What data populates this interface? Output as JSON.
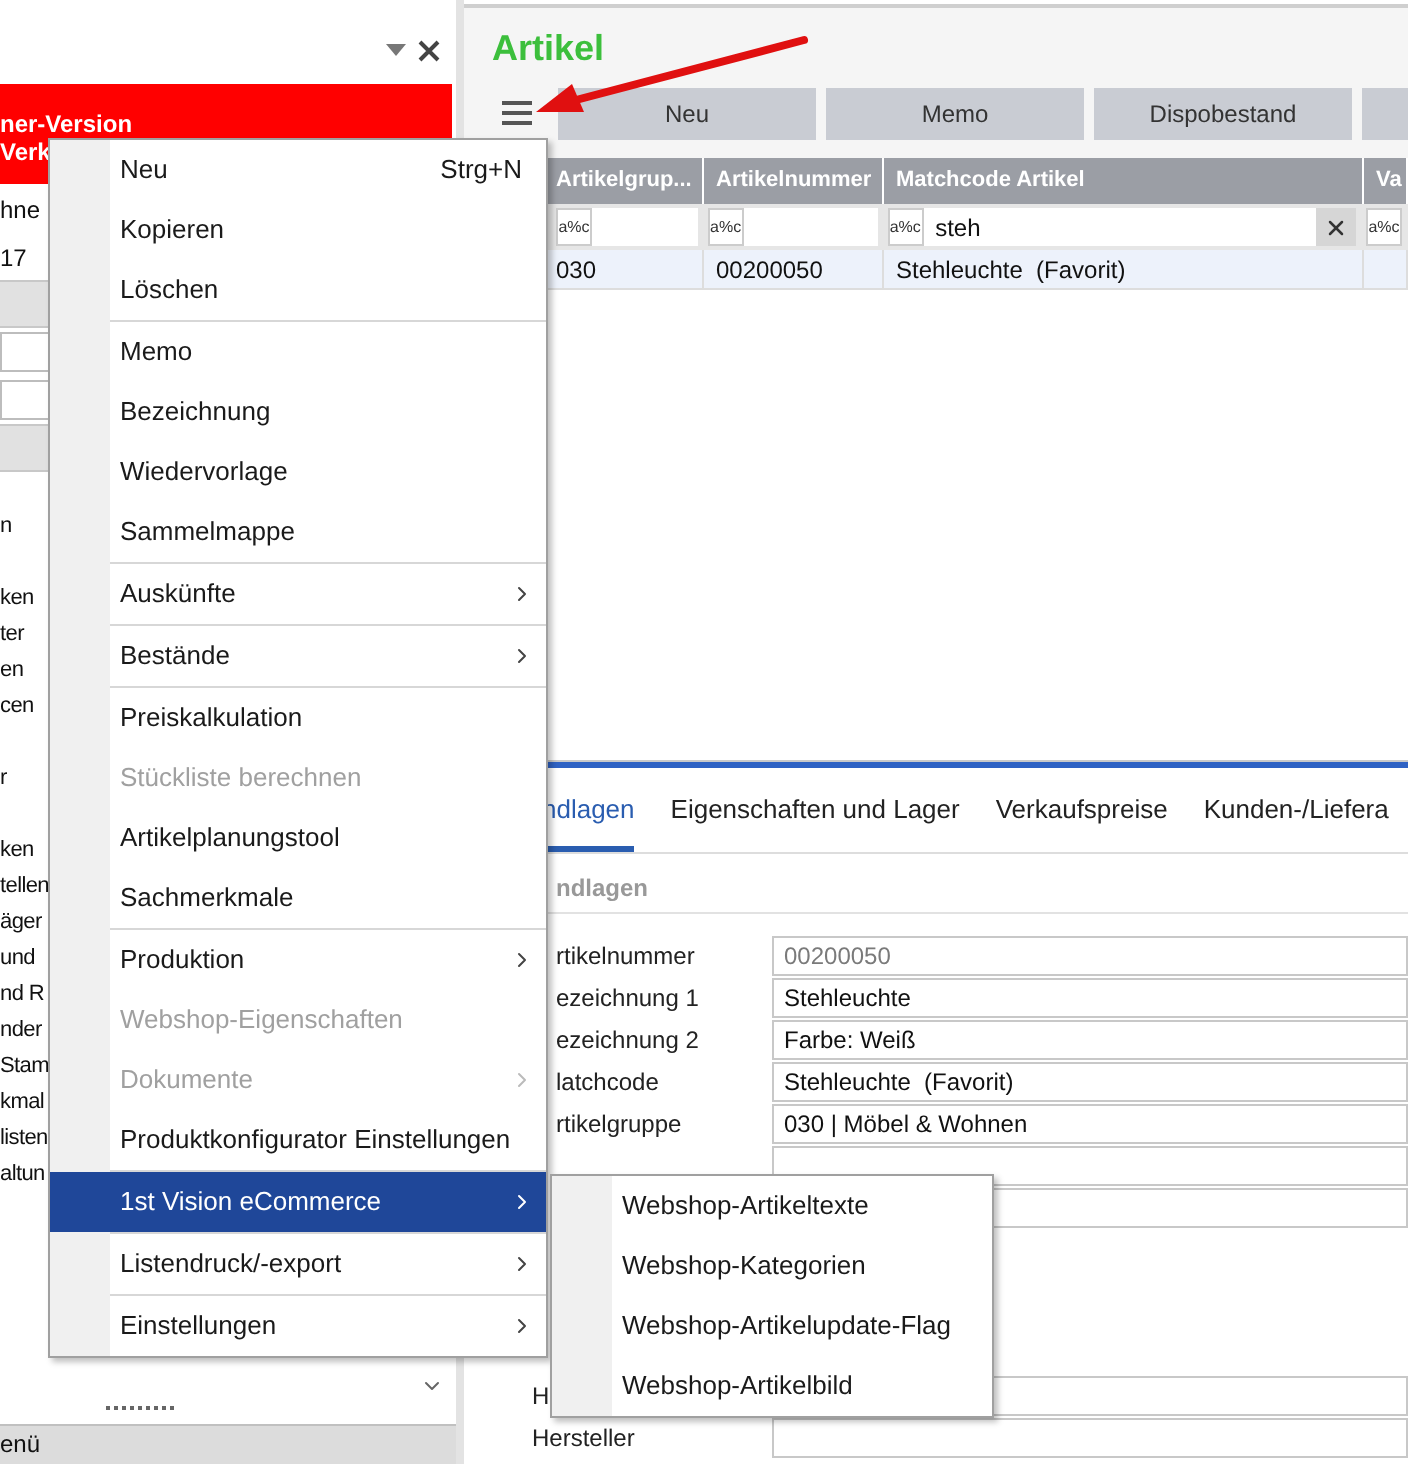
{
  "left_panel": {
    "banner_lines": [
      "ner-Version",
      "Verk"
    ],
    "info_lines": [
      "hne",
      "17"
    ],
    "list_groups": [
      [
        "n"
      ],
      [
        "ken",
        "ter",
        "en",
        "cen"
      ],
      [
        "r"
      ],
      [
        "ken",
        "tellen",
        "äger",
        "und",
        "nd R",
        "nder",
        "Stam",
        "kmal",
        "listen",
        "altun"
      ]
    ],
    "bottom_bar": "enü"
  },
  "article": {
    "title": "Artikel",
    "toolbar": [
      "Neu",
      "Memo",
      "Dispobestand"
    ],
    "grid": {
      "columns": [
        {
          "header": "Artikelgrup...",
          "filter_operator": "a%c"
        },
        {
          "header": "Artikelnummer",
          "filter_operator": "a%c"
        },
        {
          "header": "Matchcode Artikel",
          "filter_operator": "a%c",
          "filter_value": "steh"
        },
        {
          "header": "Va",
          "filter_operator": "a%c"
        }
      ],
      "rows": [
        {
          "cells": [
            "030",
            "00200050",
            "Stehleuchte  (Favorit)"
          ],
          "selected": true
        }
      ]
    },
    "tabs": [
      {
        "label": "ndlagen",
        "selected": true
      },
      {
        "label": "Eigenschaften und Lager",
        "selected": false
      },
      {
        "label": "Verkaufspreise",
        "selected": false
      },
      {
        "label": "Kunden-/Liefera",
        "selected": false
      }
    ],
    "section": "ndlagen",
    "fields": [
      {
        "label": "rtikelnummer",
        "value": "00200050",
        "readonly": true
      },
      {
        "label": "ezeichnung 1",
        "value": "Stehleuchte",
        "readonly": false
      },
      {
        "label": "ezeichnung 2",
        "value": "Farbe: Weiß",
        "readonly": false
      },
      {
        "label": "latchcode",
        "value": "Stehleuchte  (Favorit)",
        "readonly": false
      },
      {
        "label": "rtikelgruppe",
        "value": "030 | Möbel & Wohnen",
        "readonly": false
      }
    ],
    "lower_fields": [
      {
        "label": "H"
      },
      {
        "label": "Hersteller"
      }
    ]
  },
  "context_menu": {
    "groups": [
      [
        {
          "label": "Neu",
          "shortcut": "Strg+N",
          "submenu": false,
          "disabled": false,
          "selected": false
        },
        {
          "label": "Kopieren",
          "submenu": false,
          "disabled": false,
          "selected": false
        },
        {
          "label": "Löschen",
          "submenu": false,
          "disabled": false,
          "selected": false
        }
      ],
      [
        {
          "label": "Memo",
          "submenu": false,
          "disabled": false,
          "selected": false
        },
        {
          "label": "Bezeichnung",
          "submenu": false,
          "disabled": false,
          "selected": false
        },
        {
          "label": "Wiedervorlage",
          "submenu": false,
          "disabled": false,
          "selected": false
        },
        {
          "label": "Sammelmappe",
          "submenu": false,
          "disabled": false,
          "selected": false
        }
      ],
      [
        {
          "label": "Auskünfte",
          "submenu": true,
          "disabled": false,
          "selected": false
        }
      ],
      [
        {
          "label": "Bestände",
          "submenu": true,
          "disabled": false,
          "selected": false
        }
      ],
      [
        {
          "label": "Preiskalkulation",
          "submenu": false,
          "disabled": false,
          "selected": false
        },
        {
          "label": "Stückliste berechnen",
          "submenu": false,
          "disabled": true,
          "selected": false
        },
        {
          "label": "Artikelplanungstool",
          "submenu": false,
          "disabled": false,
          "selected": false
        },
        {
          "label": "Sachmerkmale",
          "submenu": false,
          "disabled": false,
          "selected": false
        }
      ],
      [
        {
          "label": "Produktion",
          "submenu": true,
          "disabled": false,
          "selected": false
        },
        {
          "label": "Webshop-Eigenschaften",
          "submenu": false,
          "disabled": true,
          "selected": false
        },
        {
          "label": "Dokumente",
          "submenu": true,
          "disabled": true,
          "selected": false
        },
        {
          "label": "Produktkonfigurator Einstellungen",
          "submenu": false,
          "disabled": false,
          "selected": false
        }
      ],
      [
        {
          "label": "1st Vision eCommerce",
          "submenu": true,
          "disabled": false,
          "selected": true
        }
      ],
      [
        {
          "label": "Listendruck/-export",
          "submenu": true,
          "disabled": false,
          "selected": false
        }
      ],
      [
        {
          "label": "Einstellungen",
          "submenu": true,
          "disabled": false,
          "selected": false
        }
      ]
    ]
  },
  "submenu": {
    "items": [
      "Webshop-Artikeltexte",
      "Webshop-Kategorien",
      "Webshop-Artikelupdate-Flag",
      "Webshop-Artikelbild"
    ]
  }
}
